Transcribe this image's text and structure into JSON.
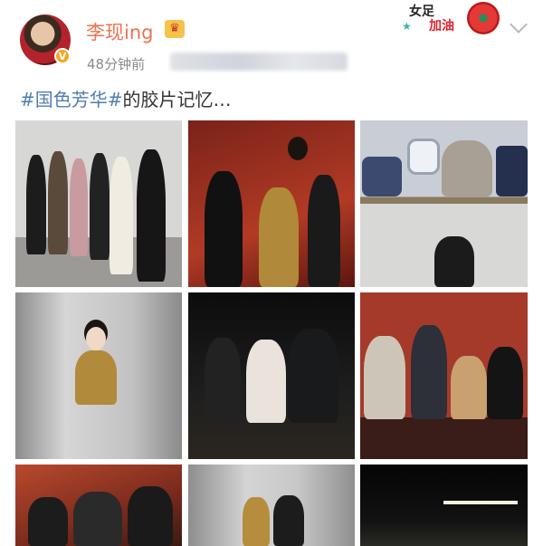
{
  "post": {
    "username": "李现ing",
    "time": "48分钟前",
    "hashtag": "#国色芳华#",
    "text": "的胶片记忆…"
  },
  "sticker": {
    "line1": "女足",
    "line2": "加油"
  },
  "icons": {
    "verified": "verified-badge-icon",
    "vip": "crown-icon",
    "more": "chevron-down-icon"
  },
  "colors": {
    "username": "#eb7350",
    "hashtag": "#507daf",
    "time": "#8a8a8a",
    "text": "#333333"
  },
  "photos": [
    {
      "id": 1,
      "desc": "group standing in front of white wall"
    },
    {
      "id": 2,
      "desc": "cast posing in front of red painted backdrop"
    },
    {
      "id": 3,
      "desc": "aircraft cabin and white backdrop"
    },
    {
      "id": 4,
      "desc": "actress in gold dress before white backdrop"
    },
    {
      "id": 5,
      "desc": "three people selfie pose dark room"
    },
    {
      "id": 6,
      "desc": "cast in costume before red backdrop"
    },
    {
      "id": 7,
      "desc": "group on floor before red backdrop"
    },
    {
      "id": 8,
      "desc": "two actresses before white backdrop"
    },
    {
      "id": 9,
      "desc": "dark room with light strip"
    }
  ]
}
